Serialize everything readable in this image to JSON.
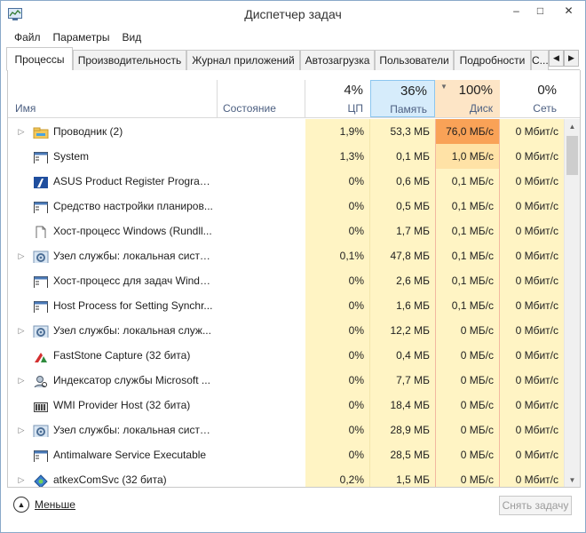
{
  "window": {
    "title": "Диспетчер задач",
    "minimize_glyph": "–",
    "maximize_glyph": "□",
    "close_glyph": "✕"
  },
  "menu": [
    "Файл",
    "Параметры",
    "Вид"
  ],
  "tabs": [
    {
      "label": "Процессы",
      "active": true
    },
    {
      "label": "Производительность"
    },
    {
      "label": "Журнал приложений"
    },
    {
      "label": "Автозагрузка"
    },
    {
      "label": "Пользователи"
    },
    {
      "label": "Подробности"
    },
    {
      "label": "С..."
    }
  ],
  "tab_scroll": {
    "left": "◀",
    "right": "▶"
  },
  "columns": {
    "name": "Имя",
    "status": "Состояние",
    "cpu": {
      "percent": "4%",
      "label": "ЦП"
    },
    "memory": {
      "percent": "36%",
      "label": "Память"
    },
    "disk": {
      "percent": "100%",
      "label": "Диск",
      "sort_glyph": "▼"
    },
    "network": {
      "percent": "0%",
      "label": "Сеть"
    }
  },
  "rows": [
    {
      "expand": "▷",
      "icon": "folder-icon",
      "name": "Проводник (2)",
      "cpu": "1,9%",
      "mem": "53,3 МБ",
      "disk": "76,0 МБ/с",
      "net": "0 Мбит/с",
      "disk_level": "hot"
    },
    {
      "expand": "",
      "icon": "window-icon",
      "name": "System",
      "cpu": "1,3%",
      "mem": "0,1 МБ",
      "disk": "1,0 МБ/с",
      "net": "0 Мбит/с",
      "disk_level": "warm"
    },
    {
      "expand": "",
      "icon": "asus-icon",
      "name": "ASUS Product Register Program...",
      "cpu": "0%",
      "mem": "0,6 МБ",
      "disk": "0,1 МБ/с",
      "net": "0 Мбит/с",
      "disk_level": "normal"
    },
    {
      "expand": "",
      "icon": "window-icon",
      "name": "Средство настройки планиров...",
      "cpu": "0%",
      "mem": "0,5 МБ",
      "disk": "0,1 МБ/с",
      "net": "0 Мбит/с",
      "disk_level": "normal"
    },
    {
      "expand": "",
      "icon": "document-icon",
      "name": "Хост-процесс Windows (Rundll...",
      "cpu": "0%",
      "mem": "1,7 МБ",
      "disk": "0,1 МБ/с",
      "net": "0 Мбит/с",
      "disk_level": "normal"
    },
    {
      "expand": "▷",
      "icon": "gear-icon",
      "name": "Узел службы: локальная систе...",
      "cpu": "0,1%",
      "mem": "47,8 МБ",
      "disk": "0,1 МБ/с",
      "net": "0 Мбит/с",
      "disk_level": "normal"
    },
    {
      "expand": "",
      "icon": "window-icon",
      "name": "Хост-процесс для задач Windo...",
      "cpu": "0%",
      "mem": "2,6 МБ",
      "disk": "0,1 МБ/с",
      "net": "0 Мбит/с",
      "disk_level": "normal"
    },
    {
      "expand": "",
      "icon": "window-icon",
      "name": "Host Process for Setting Synchr...",
      "cpu": "0%",
      "mem": "1,6 МБ",
      "disk": "0,1 МБ/с",
      "net": "0 Мбит/с",
      "disk_level": "normal"
    },
    {
      "expand": "▷",
      "icon": "gear-icon",
      "name": "Узел службы: локальная служ...",
      "cpu": "0%",
      "mem": "12,2 МБ",
      "disk": "0 МБ/с",
      "net": "0 Мбит/с",
      "disk_level": "normal"
    },
    {
      "expand": "",
      "icon": "faststone-icon",
      "name": "FastStone Capture (32 бита)",
      "cpu": "0%",
      "mem": "0,4 МБ",
      "disk": "0 МБ/с",
      "net": "0 Мбит/с",
      "disk_level": "normal"
    },
    {
      "expand": "▷",
      "icon": "user-search-icon",
      "name": "Индексатор службы Microsoft ...",
      "cpu": "0%",
      "mem": "7,7 МБ",
      "disk": "0 МБ/с",
      "net": "0 Мбит/с",
      "disk_level": "normal"
    },
    {
      "expand": "",
      "icon": "wmi-icon",
      "name": "WMI Provider Host (32 бита)",
      "cpu": "0%",
      "mem": "18,4 МБ",
      "disk": "0 МБ/с",
      "net": "0 Мбит/с",
      "disk_level": "normal"
    },
    {
      "expand": "▷",
      "icon": "gear-icon",
      "name": "Узел службы: локальная систе...",
      "cpu": "0%",
      "mem": "28,9 МБ",
      "disk": "0 МБ/с",
      "net": "0 Мбит/с",
      "disk_level": "normal"
    },
    {
      "expand": "",
      "icon": "window-icon",
      "name": "Antimalware Service Executable",
      "cpu": "0%",
      "mem": "28,5 МБ",
      "disk": "0 МБ/с",
      "net": "0 Мбит/с",
      "disk_level": "normal"
    },
    {
      "expand": "▷",
      "icon": "network-icon",
      "name": "atkexComSvc (32 бита)",
      "cpu": "0,2%",
      "mem": "1,5 МБ",
      "disk": "0 МБ/с",
      "net": "0 Мбит/с",
      "disk_level": "normal"
    }
  ],
  "scroll": {
    "up": "▲",
    "down": "▼"
  },
  "footer": {
    "less_label": "Меньше",
    "less_glyph": "▲",
    "end_task_label": "Снять задачу"
  },
  "colors": {
    "heat_low": "#fff4c4",
    "heat_warm": "#ffe2a6",
    "heat_hot": "#f9a257",
    "memory_header": "#d6ecfb",
    "disk_header": "#fde5c6",
    "disk_border": "#f2b9a0"
  }
}
